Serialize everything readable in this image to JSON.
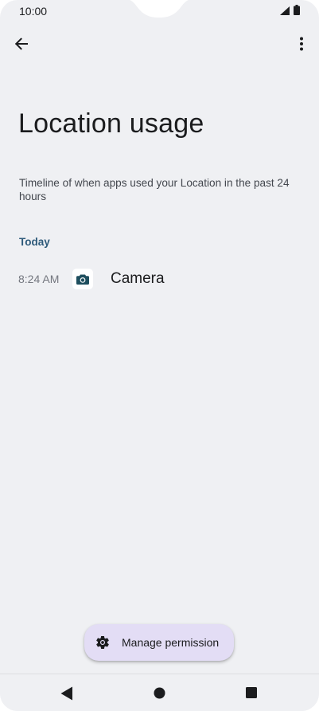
{
  "status_bar": {
    "time": "10:00",
    "signal_icon": "signal-icon",
    "battery_icon": "battery-icon"
  },
  "app_bar": {
    "back_icon": "arrow-back-icon",
    "more_icon": "more-vert-icon"
  },
  "page": {
    "title": "Location usage",
    "description": "Timeline of when apps used your Location in the past 24 hours"
  },
  "timeline": {
    "section_label": "Today",
    "entries": [
      {
        "time": "8:24 AM",
        "app_name": "Camera",
        "icon": "camera-icon"
      }
    ]
  },
  "fab": {
    "label": "Manage permission",
    "icon": "settings-gear-icon"
  },
  "nav_bar": {
    "back_icon": "nav-back-icon",
    "home_icon": "nav-home-icon",
    "recents_icon": "nav-recents-icon"
  },
  "colors": {
    "background": "#eff0f3",
    "section_header": "#2e5a7a",
    "fab_background": "#e3ddf5",
    "camera_icon": "#1e4e5e"
  }
}
